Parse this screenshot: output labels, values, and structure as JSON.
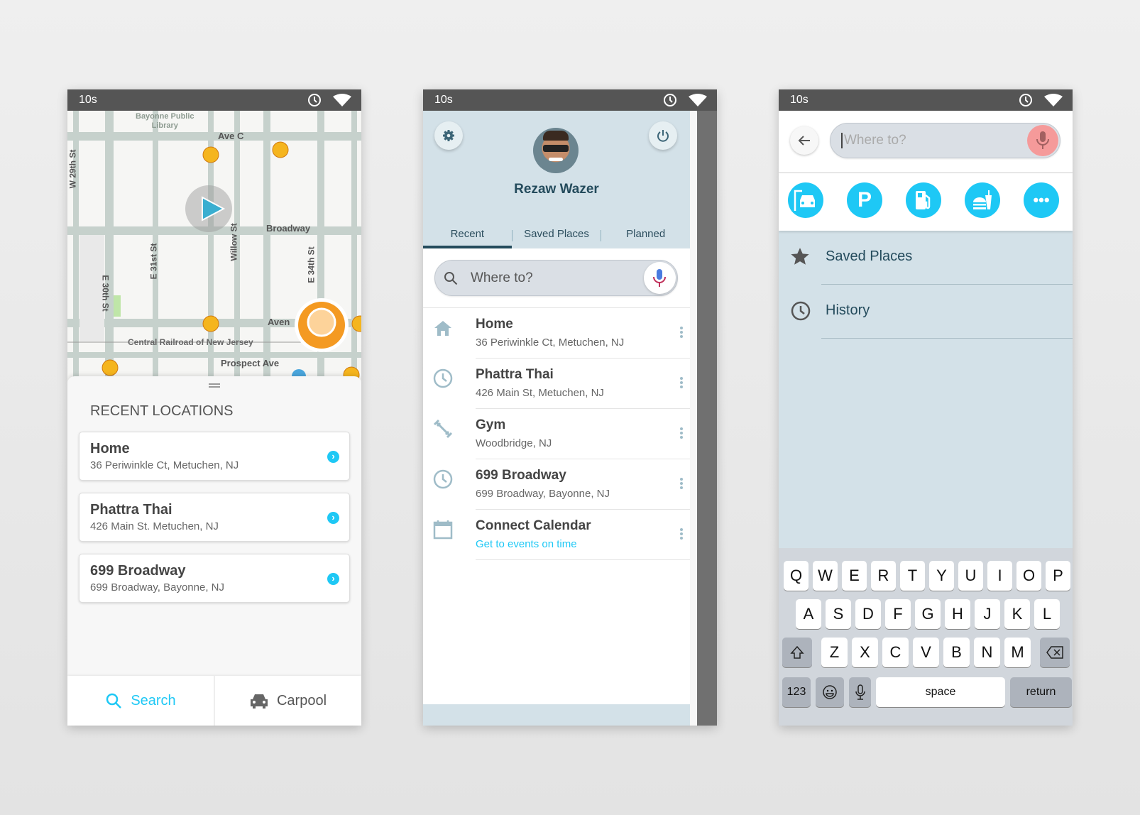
{
  "status": {
    "time": "10s",
    "clock_icon": "clock-icon",
    "wifi_icon": "wifi-icon"
  },
  "screen1": {
    "map": {
      "labels": [
        "Bayonne Public",
        "Library",
        "Ave C",
        "W 29th St",
        "Broadway",
        "E 31st St",
        "Willow St",
        "E 30th St",
        "E 34th St",
        "Aven",
        "Central Railroad of New Jersey",
        "Prospect Ave"
      ]
    },
    "section_title": "RECENT LOCATIONS",
    "recent": [
      {
        "name": "Home",
        "address": "36 Periwinkle Ct, Metuchen, NJ"
      },
      {
        "name": "Phattra Thai",
        "address": "426 Main St. Metuchen, NJ"
      },
      {
        "name": "699 Broadway",
        "address": "699 Broadway, Bayonne, NJ"
      }
    ],
    "bottom": {
      "search": "Search",
      "carpool": "Carpool"
    },
    "accent": "#1ec8f5"
  },
  "screen2": {
    "user_name": "Rezaw Wazer",
    "tabs": [
      "Recent",
      "Saved Places",
      "Planned"
    ],
    "active_tab": "Recent",
    "search_placeholder": "Where to?",
    "items": [
      {
        "icon": "home-icon",
        "name": "Home",
        "sub": "36 Periwinkle Ct, Metuchen, NJ"
      },
      {
        "icon": "clock-icon",
        "name": "Phattra Thai",
        "sub": "426 Main St, Metuchen, NJ"
      },
      {
        "icon": "dumbbell-icon",
        "name": "Gym",
        "sub": "Woodbridge, NJ"
      },
      {
        "icon": "clock-icon",
        "name": "699 Broadway",
        "sub": "699 Broadway, Bayonne, NJ"
      },
      {
        "icon": "calendar-icon",
        "name": "Connect Calendar",
        "sub": "Get to events on time"
      }
    ]
  },
  "screen3": {
    "search_placeholder": "Where to?",
    "categories": [
      "garage-icon",
      "parking-icon",
      "gas-station-icon",
      "food-icon",
      "more-icon"
    ],
    "menu": [
      {
        "icon": "star-icon",
        "label": "Saved Places"
      },
      {
        "icon": "clock-icon",
        "label": "History"
      }
    ],
    "keyboard": {
      "row1": [
        "Q",
        "W",
        "E",
        "R",
        "T",
        "Y",
        "U",
        "I",
        "O",
        "P"
      ],
      "row2": [
        "A",
        "S",
        "D",
        "F",
        "G",
        "H",
        "J",
        "K",
        "L"
      ],
      "row3": [
        "Z",
        "X",
        "C",
        "V",
        "B",
        "N",
        "M"
      ],
      "numbers": "123",
      "space": "space",
      "return": "return"
    }
  }
}
